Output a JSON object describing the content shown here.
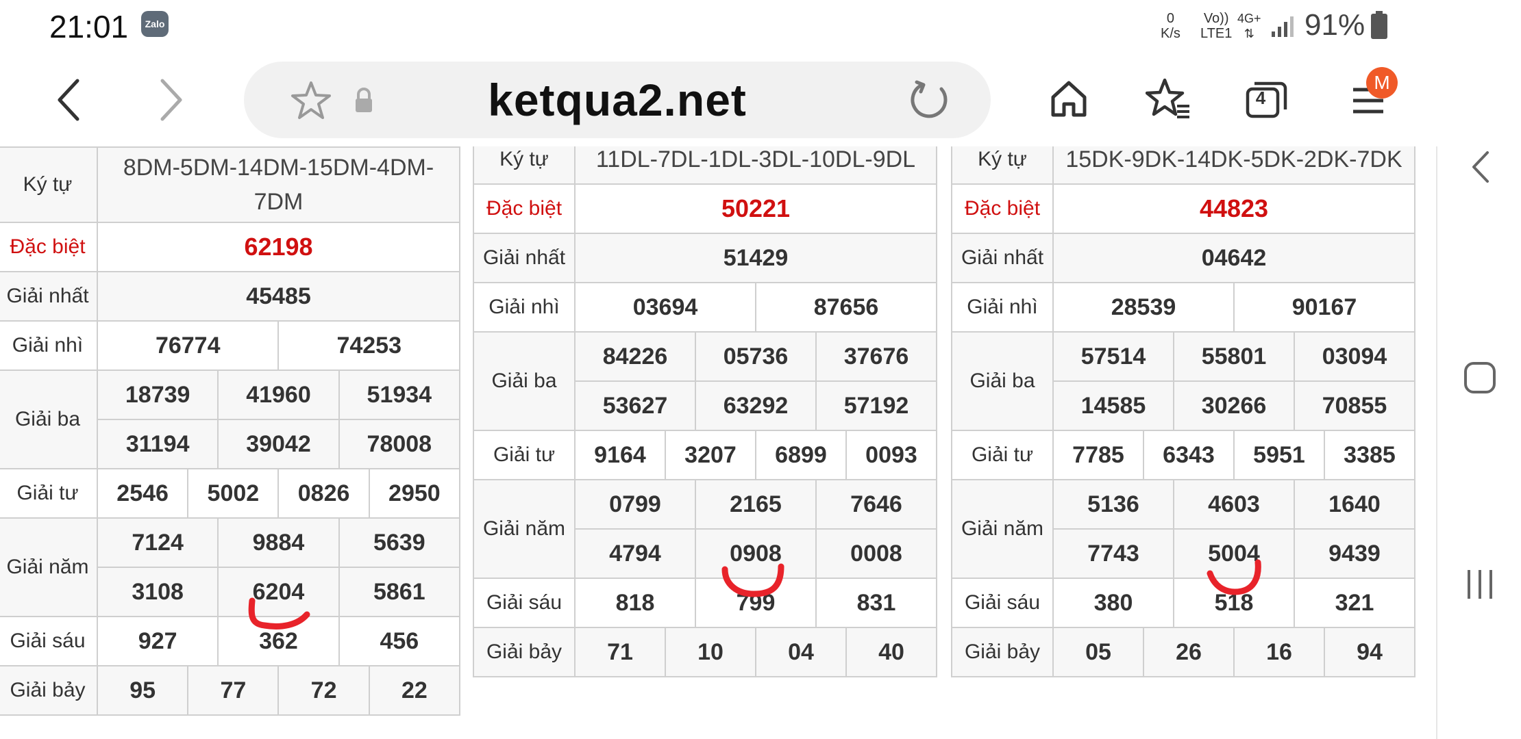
{
  "status": {
    "time": "21:01",
    "zalo_label": "Zalo",
    "net_speed_value": "0",
    "net_speed_unit": "K/s",
    "volte_top": "Vo))",
    "volte_bottom": "LTE1",
    "network": "4G+",
    "battery": "91%"
  },
  "browser": {
    "url": "ketqua2.net",
    "tab_count": "4",
    "menu_badge": "M"
  },
  "tables": [
    {
      "label_kytu": "Ký tự",
      "kytu": "8DM-5DM-14DM-15DM-4DM-7DM",
      "label_db": "Đặc biệt",
      "db": "62198",
      "label_g1": "Giải nhất",
      "g1": "45485",
      "label_g2": "Giải nhì",
      "g2": [
        "76774",
        "74253"
      ],
      "label_g3": "Giải ba",
      "g3": [
        "18739",
        "41960",
        "51934",
        "31194",
        "39042",
        "78008"
      ],
      "label_g4": "Giải tư",
      "g4": [
        "2546",
        "5002",
        "0826",
        "2950"
      ],
      "label_g5": "Giải năm",
      "g5": [
        "7124",
        "9884",
        "5639",
        "3108",
        "6204",
        "5861"
      ],
      "label_g6": "Giải sáu",
      "g6": [
        "927",
        "362",
        "456"
      ],
      "label_g7": "Giải bảy",
      "g7": [
        "95",
        "77",
        "72",
        "22"
      ]
    },
    {
      "label_kytu": "Ký tự",
      "kytu": "11DL-7DL-1DL-3DL-10DL-9DL",
      "label_db": "Đặc biệt",
      "db": "50221",
      "label_g1": "Giải nhất",
      "g1": "51429",
      "label_g2": "Giải nhì",
      "g2": [
        "03694",
        "87656"
      ],
      "label_g3": "Giải ba",
      "g3": [
        "84226",
        "05736",
        "37676",
        "53627",
        "63292",
        "57192"
      ],
      "label_g4": "Giải tư",
      "g4": [
        "9164",
        "3207",
        "6899",
        "0093"
      ],
      "label_g5": "Giải năm",
      "g5": [
        "0799",
        "2165",
        "7646",
        "4794",
        "0908",
        "0008"
      ],
      "label_g6": "Giải sáu",
      "g6": [
        "818",
        "799",
        "831"
      ],
      "label_g7": "Giải bảy",
      "g7": [
        "71",
        "10",
        "04",
        "40"
      ]
    },
    {
      "label_kytu": "Ký tự",
      "kytu": "15DK-9DK-14DK-5DK-2DK-7DK",
      "label_db": "Đặc biệt",
      "db": "44823",
      "label_g1": "Giải nhất",
      "g1": "04642",
      "label_g2": "Giải nhì",
      "g2": [
        "28539",
        "90167"
      ],
      "label_g3": "Giải ba",
      "g3": [
        "57514",
        "55801",
        "03094",
        "14585",
        "30266",
        "70855"
      ],
      "label_g4": "Giải tư",
      "g4": [
        "7785",
        "6343",
        "5951",
        "3385"
      ],
      "label_g5": "Giải năm",
      "g5": [
        "5136",
        "4603",
        "1640",
        "7743",
        "5004",
        "9439"
      ],
      "label_g6": "Giải sáu",
      "g6": [
        "380",
        "518",
        "321"
      ],
      "label_g7": "Giải bảy",
      "g7": [
        "05",
        "26",
        "16",
        "94"
      ]
    }
  ],
  "colors": {
    "accent_red": "#d01010",
    "scribble_red": "#e8232a",
    "badge_orange": "#f05a28"
  },
  "icons": {
    "back": "chevron-left-icon",
    "forward": "chevron-right-icon",
    "bookmark": "star-icon",
    "lock": "lock-icon",
    "reload": "reload-icon",
    "home": "home-icon",
    "bookmarks": "bookmarks-icon",
    "tabs": "tabs-icon",
    "menu": "menu-icon",
    "nav_back": "nav-back-icon",
    "nav_home": "nav-home-icon",
    "nav_recents": "nav-recents-icon"
  }
}
